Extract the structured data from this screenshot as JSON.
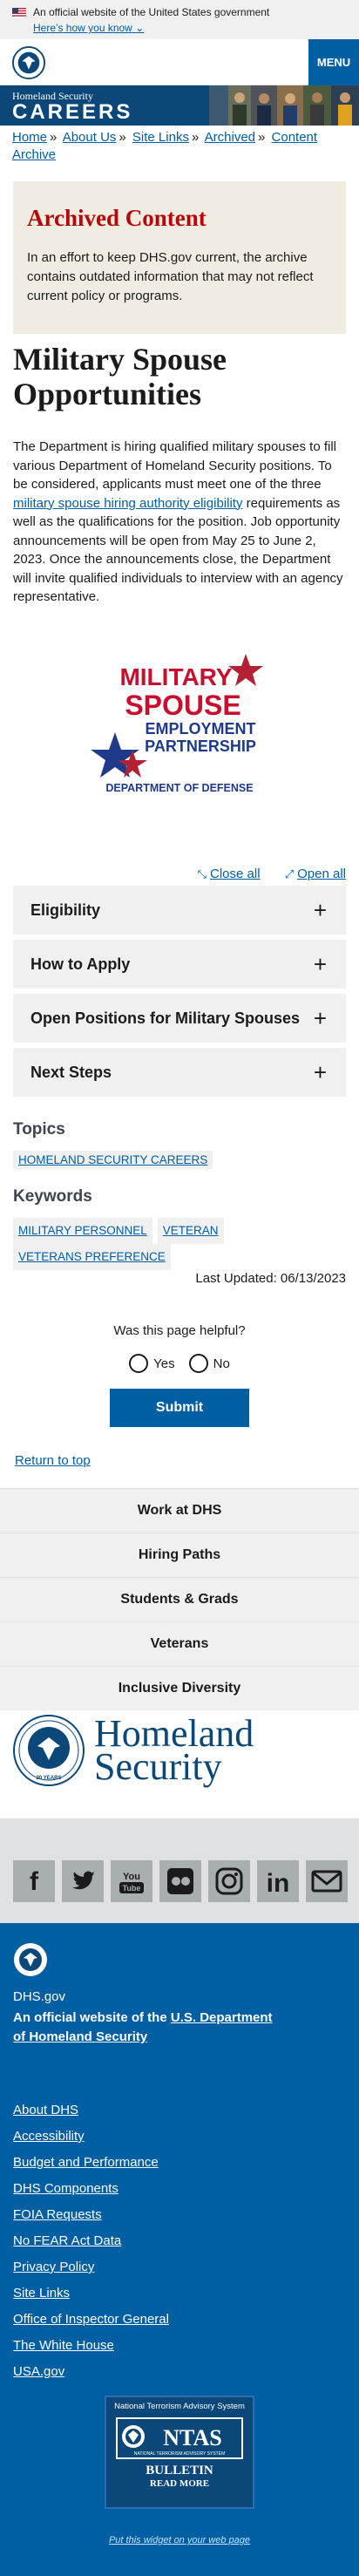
{
  "gov_banner": {
    "text": "An official website of the United States government",
    "link": "Here’s how you know"
  },
  "header": {
    "menu_label": "MENU"
  },
  "careers_banner": {
    "line1": "Homeland Security",
    "line2": "CAREERS"
  },
  "breadcrumb": [
    "Home",
    "About Us",
    "Site Links",
    "Archived",
    "Content Archive"
  ],
  "archived": {
    "title": "Archived Content",
    "body": "In an effort to keep DHS.gov current, the archive contains outdated information that may not reflect current policy or programs."
  },
  "page_title": "Military Spouse Opportunities",
  "intro": {
    "part1": "The Department is hiring qualified military spouses to fill various Department of Homeland Security positions. To be considered, applicants must meet one of the three ",
    "link": "military spouse hiring authority eligibility",
    "part2": " requirements as well as the qualifications for the position. Job opportunity announcements will be open from May 25 to June 2, 2023. Once the announcements close, the Department will invite qualified individuals to interview with an agency representative."
  },
  "logo": {
    "line1": "MILITARY",
    "line2": "SPOUSE",
    "line3": "EMPLOYMENT",
    "line4": "PARTNERSHIP",
    "line5": "DEPARTMENT OF DEFENSE"
  },
  "toggles": {
    "close_all": "Close all",
    "open_all": "Open all"
  },
  "accordion": [
    "Eligibility",
    "How to Apply",
    "Open Positions for Military Spouses",
    "Next Steps"
  ],
  "topics": {
    "heading": "Topics",
    "tags": [
      "HOMELAND SECURITY CAREERS"
    ]
  },
  "keywords": {
    "heading": "Keywords",
    "tags": [
      "MILITARY PERSONNEL",
      "VETERAN",
      "VETERANS PREFERENCE"
    ]
  },
  "last_updated": "Last Updated: 06/13/2023",
  "feedback": {
    "question": "Was this page helpful?",
    "yes": "Yes",
    "no": "No",
    "submit": "Submit"
  },
  "return_top": "Return to top",
  "footer_nav": [
    "Work at DHS",
    "Hiring Paths",
    "Students & Grads",
    "Veterans",
    "Inclusive Diversity"
  ],
  "brand": {
    "line1": "Homeland",
    "line2": "Security",
    "seal_text": "20 YEARS"
  },
  "social": [
    "facebook-icon",
    "twitter-icon",
    "youtube-icon",
    "flickr-icon",
    "instagram-icon",
    "linkedin-icon",
    "email-icon"
  ],
  "footer": {
    "domain": "DHS.gov",
    "official_prefix": "An official website of the ",
    "official_link": "U.S. Department of Homeland Security",
    "links": [
      "About DHS",
      "Accessibility",
      "Budget and Performance",
      "DHS Components",
      "FOIA Requests",
      "No FEAR Act Data",
      "Privacy Policy",
      "Site Links",
      "Office of Inspector General",
      "The White House",
      "USA.gov"
    ]
  },
  "ntas": {
    "title": "National Terrorism Advisory System",
    "acronym": "NTAS",
    "subtitle": "NATIONAL TERRORISM ADVISORY SYSTEM",
    "bulletin": "BULLETIN",
    "read_more": "READ MORE",
    "widget": "Put this widget on your web page"
  },
  "colors": {
    "primary": "#005ea2",
    "dark_blue": "#0b4778",
    "archived_red": "#b50909",
    "archived_bg": "#f1ece2"
  }
}
